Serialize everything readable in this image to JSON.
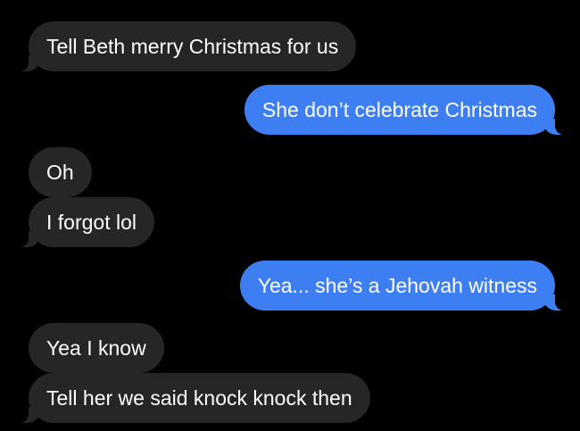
{
  "conversation": {
    "messages": [
      {
        "direction": "incoming",
        "text": "Tell Beth merry Christmas for us"
      },
      {
        "direction": "outgoing",
        "text": "She don’t celebrate Christmas"
      },
      {
        "direction": "incoming",
        "text": "Oh"
      },
      {
        "direction": "incoming",
        "text": "I forgot lol"
      },
      {
        "direction": "outgoing",
        "text": "Yea... she’s a Jehovah witness"
      },
      {
        "direction": "incoming",
        "text": "Yea I know"
      },
      {
        "direction": "incoming",
        "text": "Tell her we said knock knock then"
      }
    ]
  },
  "colors": {
    "background": "#000000",
    "incoming_bubble": "#262629",
    "outgoing_bubble": "#3d7ff2",
    "text": "#ffffff"
  }
}
